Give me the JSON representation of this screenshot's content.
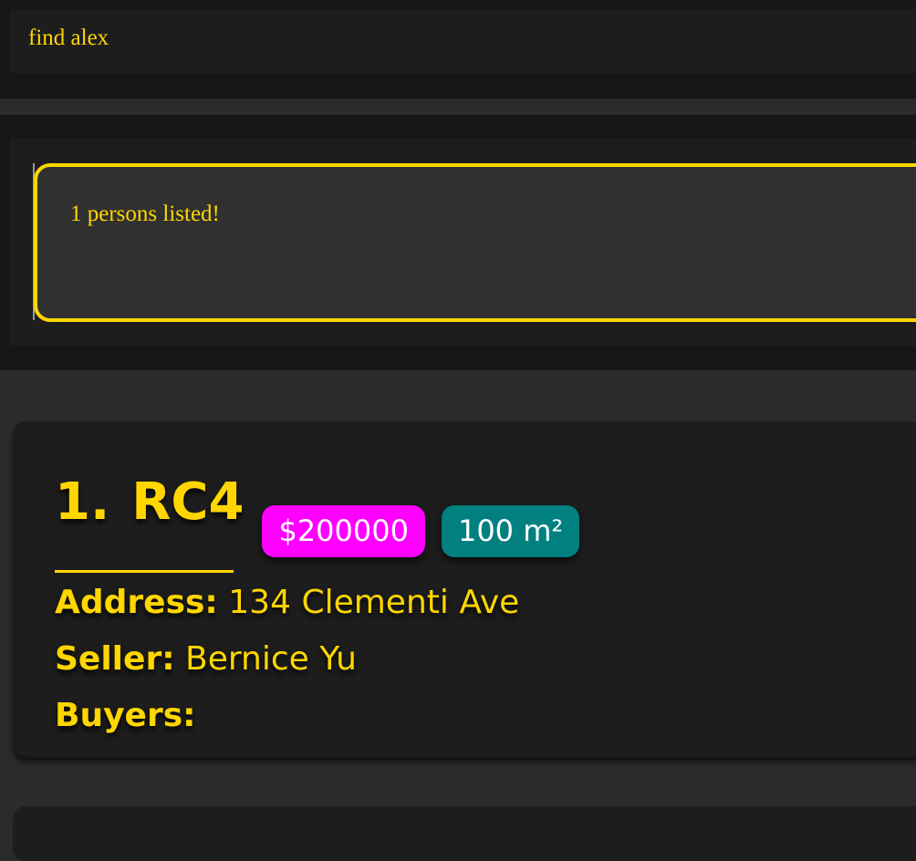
{
  "command": {
    "input_value": "find alex"
  },
  "result": {
    "message": "1 persons listed!"
  },
  "listing": {
    "index": "1.",
    "name": "RC4",
    "price": "$200000",
    "size": "100 m²",
    "address_label": "Address:",
    "address": "134 Clementi Ave",
    "seller_label": "Seller:",
    "seller": "Bernice Yu",
    "buyers_label": "Buyers:",
    "buyers": ""
  },
  "colors": {
    "accent": "#ffd600",
    "price_tag": "#ff00ff",
    "size_tag": "#00807f",
    "card_background": "#1d1d1d",
    "result_background": "#303030"
  }
}
